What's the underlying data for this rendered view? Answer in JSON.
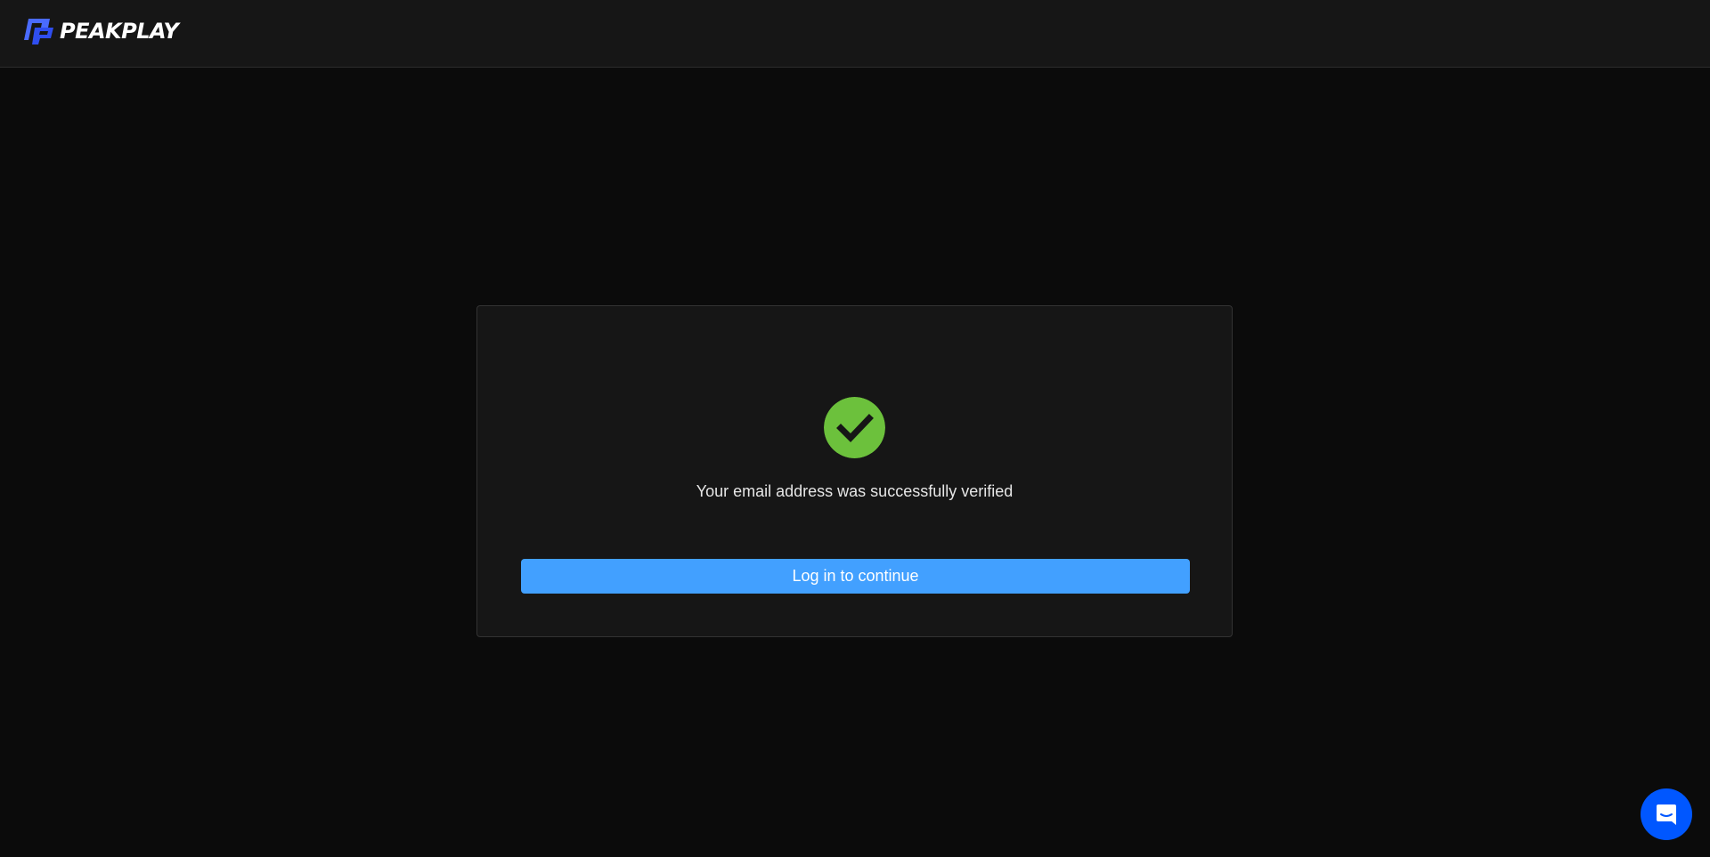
{
  "header": {
    "logo_text": "PEAKPLAY",
    "logo_icon": "peakplay-logo-mark"
  },
  "verification": {
    "icon": "check-circle-icon",
    "message": "Your email address was successfully verified",
    "login_button_label": "Log in to continue"
  },
  "chat": {
    "icon": "chat-icon"
  },
  "colors": {
    "page_background": "#0b0b0b",
    "header_background": "#161616",
    "card_background": "#161616",
    "brand_blue": "#3b5bff",
    "success_green": "#6cc13c",
    "button_blue": "#42a0ff",
    "chat_launcher_blue": "#0057ff"
  }
}
